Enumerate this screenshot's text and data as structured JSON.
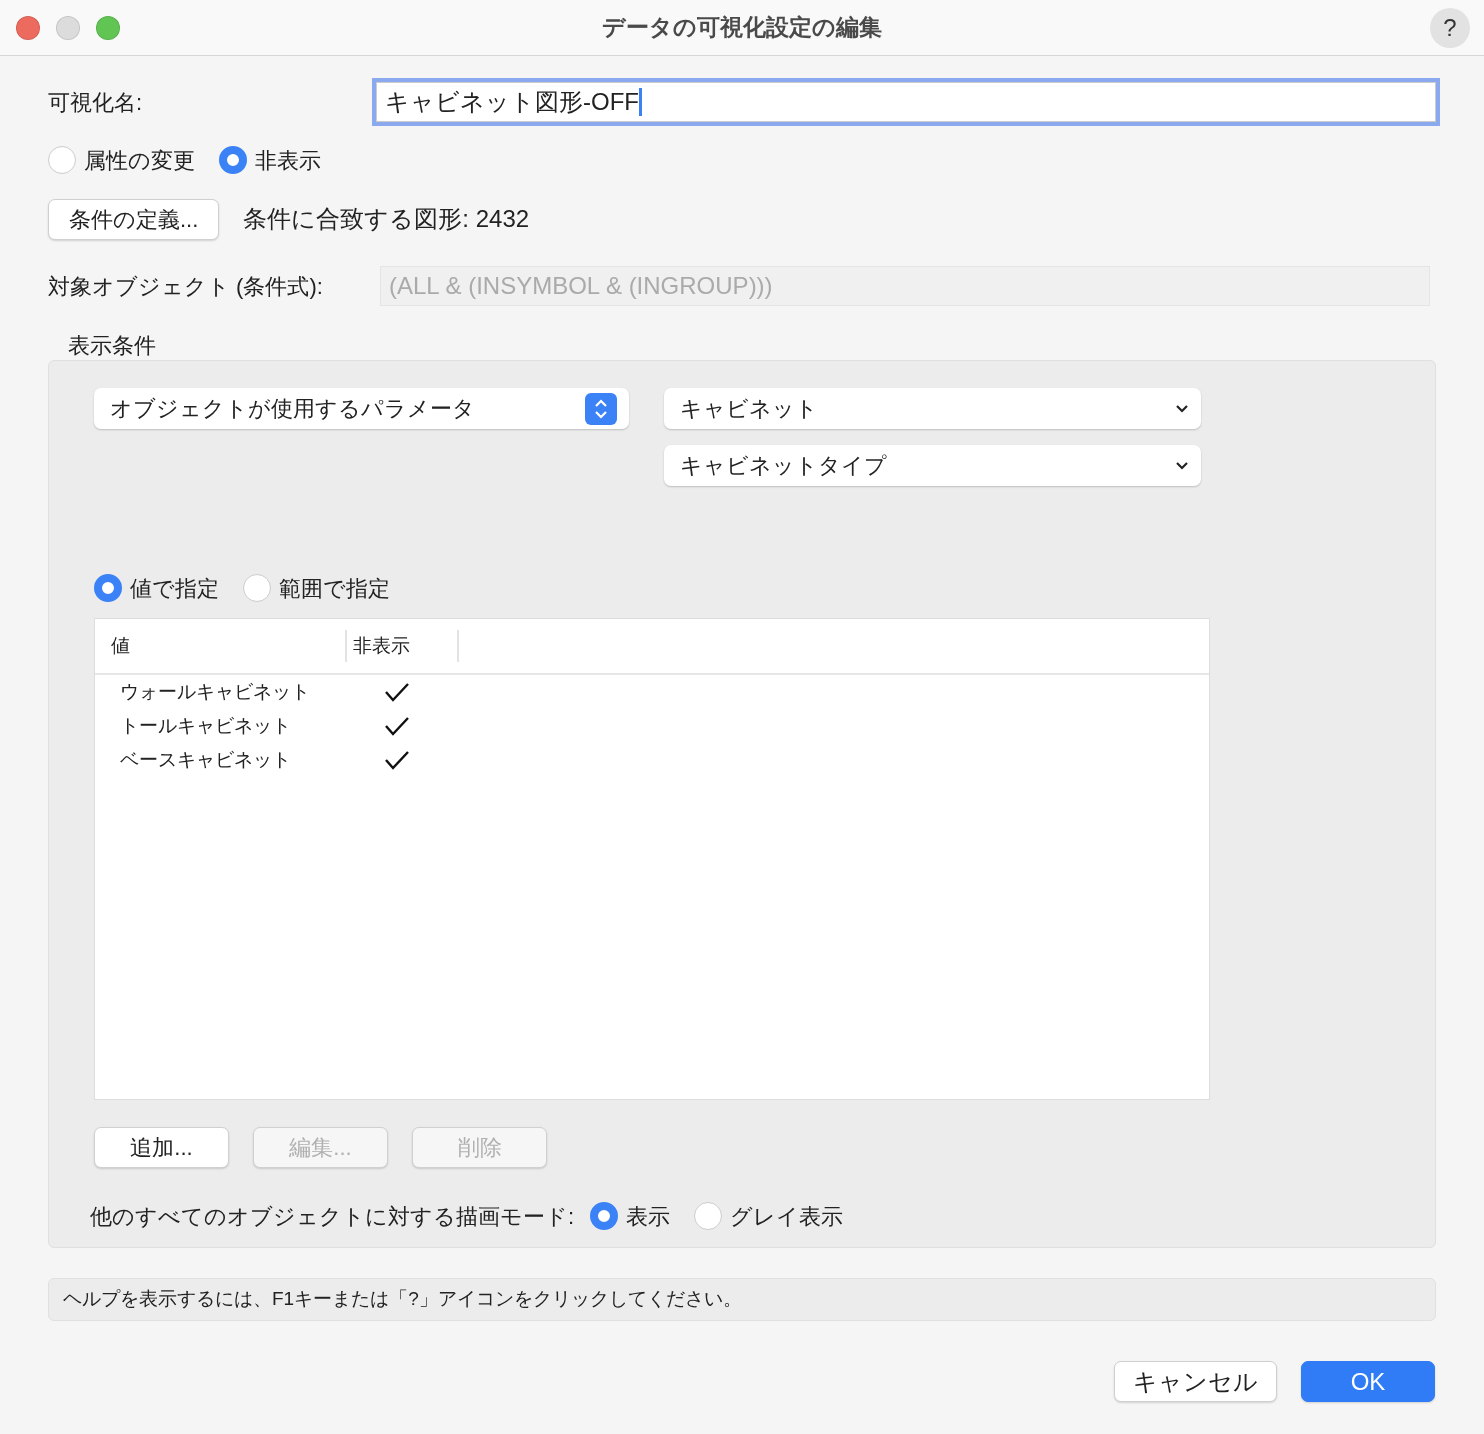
{
  "window": {
    "title": "データの可視化設定の編集",
    "help_button": "?"
  },
  "name_field": {
    "label": "可視化名:",
    "value": "キャビネット図形-OFF",
    "focused": true
  },
  "mode_options": [
    {
      "label": "属性の変更",
      "selected": false
    },
    {
      "label": "非表示",
      "selected": true
    }
  ],
  "define_button": {
    "label": "条件の定義...",
    "disabled": false
  },
  "match_count": "条件に合致する図形: 2432",
  "criteria": {
    "label": "対象オブジェクト (条件式):",
    "value": "(ALL & (INSYMBOL & (INGROUP)))",
    "disabled": true
  },
  "display_conditions": {
    "title": "表示条件",
    "source_popup": "オブジェクトが使用するパラメータ",
    "object_dropdown": "キャビネット",
    "parameter_dropdown": "キャビネットタイプ",
    "spec_options": [
      {
        "label": "値で指定",
        "selected": true
      },
      {
        "label": "範囲で指定",
        "selected": false
      }
    ],
    "table": {
      "columns": [
        "値",
        "非表示"
      ],
      "rows": [
        {
          "value": "ウォールキャビネット",
          "hidden": true
        },
        {
          "value": "トールキャビネット",
          "hidden": true
        },
        {
          "value": "ベースキャビネット",
          "hidden": true
        }
      ]
    },
    "buttons": [
      {
        "label": "追加...",
        "disabled": false
      },
      {
        "label": "編集...",
        "disabled": true
      },
      {
        "label": "削除",
        "disabled": true
      }
    ],
    "other_mode": {
      "label": "他のすべてのオブジェクトに対する描画モード:",
      "options": [
        {
          "label": "表示",
          "selected": true
        },
        {
          "label": "グレイ表示",
          "selected": false
        }
      ]
    }
  },
  "help_text": "ヘルプを表示するには、F1キーまたは「?」アイコンをクリックしてください。",
  "buttons": [
    {
      "label": "キャンセル",
      "kind": "default"
    },
    {
      "label": "OK",
      "kind": "primary"
    }
  ]
}
